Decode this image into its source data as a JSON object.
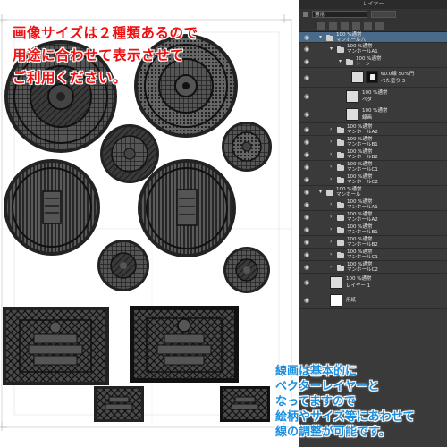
{
  "banner": {
    "line1": "画像サイズは２種類あるので",
    "line2": "用途に合わせて表示させて",
    "line3": "ご利用ください。"
  },
  "note": {
    "line1": "線画は基本的に",
    "line2": "ベクターレイヤーと",
    "line3": "なってますので",
    "line4": "絵柄やサイズ等にあわせて",
    "line5": "線の調整が可能です。"
  },
  "panel": {
    "title": "レイヤー",
    "blend_mode": "通常",
    "layers": [
      {
        "label1": "100 %通常",
        "label2": "マンホール穴"
      },
      {
        "label1": "100 %通常",
        "label2": "マンホールA1"
      },
      {
        "label1": "100 %通常",
        "label2": "トーン"
      },
      {
        "label1": "60.0線 50%円",
        "label2": "べた塗り 3"
      },
      {
        "label1": "100 %通常",
        "label2": "ベタ"
      },
      {
        "label1": "100 %通常",
        "label2": "線画"
      },
      {
        "label1": "100 %通常",
        "label2": "マンホールA2"
      },
      {
        "label1": "100 %通常",
        "label2": "マンホールB1"
      },
      {
        "label1": "100 %通常",
        "label2": "マンホールB2"
      },
      {
        "label1": "100 %通常",
        "label2": "マンホールC1"
      },
      {
        "label1": "100 %通常",
        "label2": "マンホールC2"
      },
      {
        "label1": "100 %通常",
        "label2": "マンホール"
      },
      {
        "label1": "100 %通常",
        "label2": "マンホールA1"
      },
      {
        "label1": "100 %通常",
        "label2": "マンホールA2"
      },
      {
        "label1": "100 %通常",
        "label2": "マンホールB1"
      },
      {
        "label1": "100 %通常",
        "label2": "マンホールB2"
      },
      {
        "label1": "100 %通常",
        "label2": "マンホールC1"
      },
      {
        "label1": "100 %通常",
        "label2": "マンホールC2"
      },
      {
        "label1": "100 %通常",
        "label2": "レイヤー 1"
      },
      {
        "label1": "",
        "label2": "用紙"
      }
    ]
  }
}
